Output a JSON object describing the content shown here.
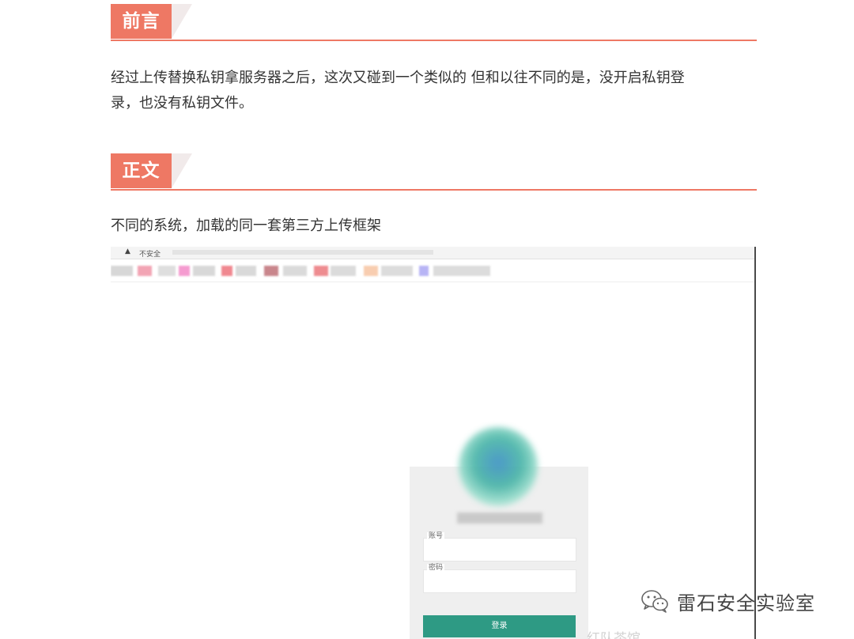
{
  "sections": [
    {
      "heading": "前言"
    },
    {
      "heading": "正文"
    }
  ],
  "paragraphs": {
    "intro_line1": "经过上传替换私钥拿服务器之后，这次又碰到一个类似的 但和以往不同的是，没开启私钥登",
    "intro_line2": "录，也没有私钥文件。",
    "body_caption": "不同的系统，加载的同一套第三方上传框架"
  },
  "screenshot": {
    "security_label": "不安全",
    "username_label": "账号",
    "password_label": "密码",
    "login_button": "登录",
    "faint_overlay_text": "红队茶馆"
  },
  "watermark": {
    "icon": "wechat-icon",
    "text": "雷石安全实验室"
  },
  "colors": {
    "accent": "#ee7864",
    "button_green": "#2e9a84",
    "text": "#333333"
  }
}
